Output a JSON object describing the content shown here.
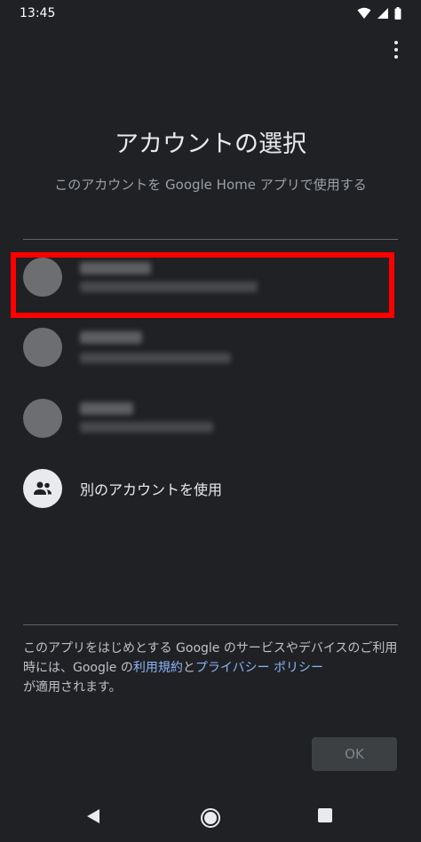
{
  "status_bar": {
    "time": "13:45"
  },
  "header": {
    "title": "アカウントの選択",
    "subtitle": "このアカウントを Google Home アプリで使用する"
  },
  "accounts": [
    {
      "name": "",
      "email": ""
    },
    {
      "name": "",
      "email": ""
    },
    {
      "name": "",
      "email": ""
    }
  ],
  "other_account": {
    "label": "別のアカウントを使用",
    "icon": "people-icon"
  },
  "legal": {
    "text_before": "このアプリをはじめとする Google のサービスやデバイスのご利用時には、Google の",
    "terms_link": "利用規約",
    "and": "と",
    "privacy_link": "プライバシー ポリシー",
    "text_after": "が適用されます。"
  },
  "actions": {
    "ok_label": "OK"
  },
  "colors": {
    "background": "#202124",
    "link": "#8ab4f8",
    "highlight": "#ff0000"
  }
}
